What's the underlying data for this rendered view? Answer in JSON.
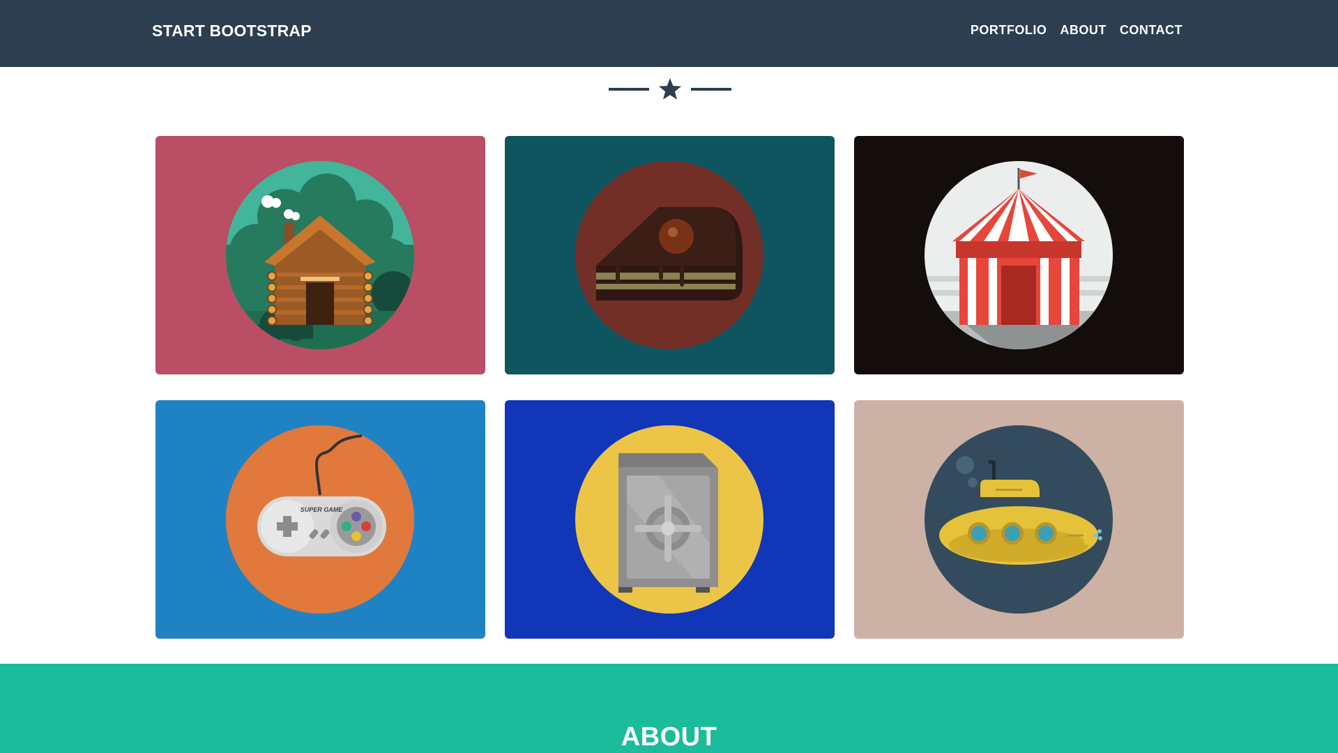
{
  "navbar": {
    "brand": "START BOOTSTRAP",
    "links": [
      "PORTFOLIO",
      "ABOUT",
      "CONTACT"
    ]
  },
  "divider": {
    "icon": "star-icon"
  },
  "portfolio": {
    "items": [
      {
        "name": "log-cabin",
        "icon": "cabin-icon",
        "bg": "#b94e65",
        "circle": "#42b59b"
      },
      {
        "name": "cake",
        "icon": "cake-icon",
        "bg": "#0e5560",
        "circle": "#722f27"
      },
      {
        "name": "circus-tent",
        "icon": "circus-tent-icon",
        "bg": "#130e0c",
        "circle": "#eceeee"
      },
      {
        "name": "game-controller",
        "icon": "game-controller-icon",
        "bg": "#1f83c3",
        "circle": "#e1793c"
      },
      {
        "name": "safe",
        "icon": "safe-icon",
        "bg": "#1136b7",
        "circle": "#ecc548"
      },
      {
        "name": "submarine",
        "icon": "submarine-icon",
        "bg": "#cbb2a4",
        "circle": "#344b5d"
      }
    ],
    "controller_brand": "SUPER GAME"
  },
  "about": {
    "title": "ABOUT"
  }
}
